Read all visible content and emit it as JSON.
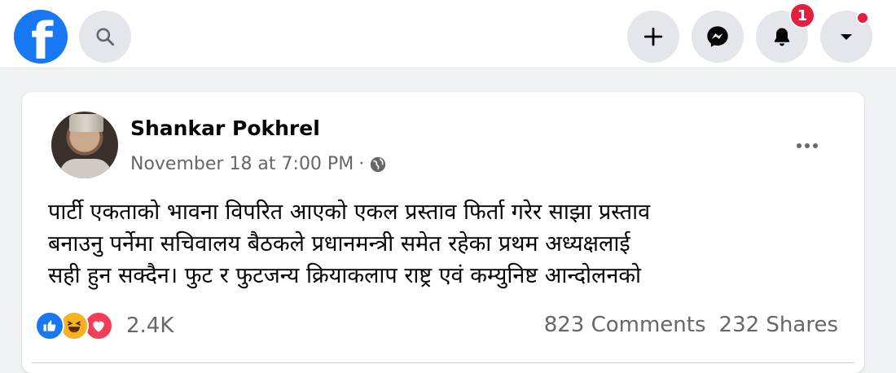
{
  "topbar": {
    "logo": "f",
    "icons": {
      "search": "search-icon",
      "create": "plus-icon",
      "messenger": "messenger-icon",
      "notifications": "bell-icon",
      "account": "caret-down-icon"
    },
    "notification_count": "1"
  },
  "post": {
    "author": "Shankar Pokhrel",
    "timestamp": "November 18 at 7:00 PM",
    "separator": "·",
    "audience_icon": "globe-icon",
    "text_lines": [
      "पार्टी एकताको भावना विपरित आएको एकल प्रस्ताव फिर्ता गरेर साझा प्रस्ताव",
      "बनाउनु पर्नेमा सचिवालय बैठकले प्रधानमन्त्री समेत रहेका प्रथम अध्यक्षलाई",
      "सही हुन सक्दैन। फुट र फुटजन्य क्रियाकलाप राष्ट्र एवं कम्युनिष्ट आन्दोलनको"
    ],
    "reactions": {
      "types": [
        "like",
        "haha",
        "love"
      ],
      "count": "2.4K"
    },
    "comments": "823 Comments",
    "shares": "232 Shares"
  },
  "colors": {
    "brand": "#1877f2",
    "badge": "#e41e3f",
    "muted": "#65676b"
  }
}
